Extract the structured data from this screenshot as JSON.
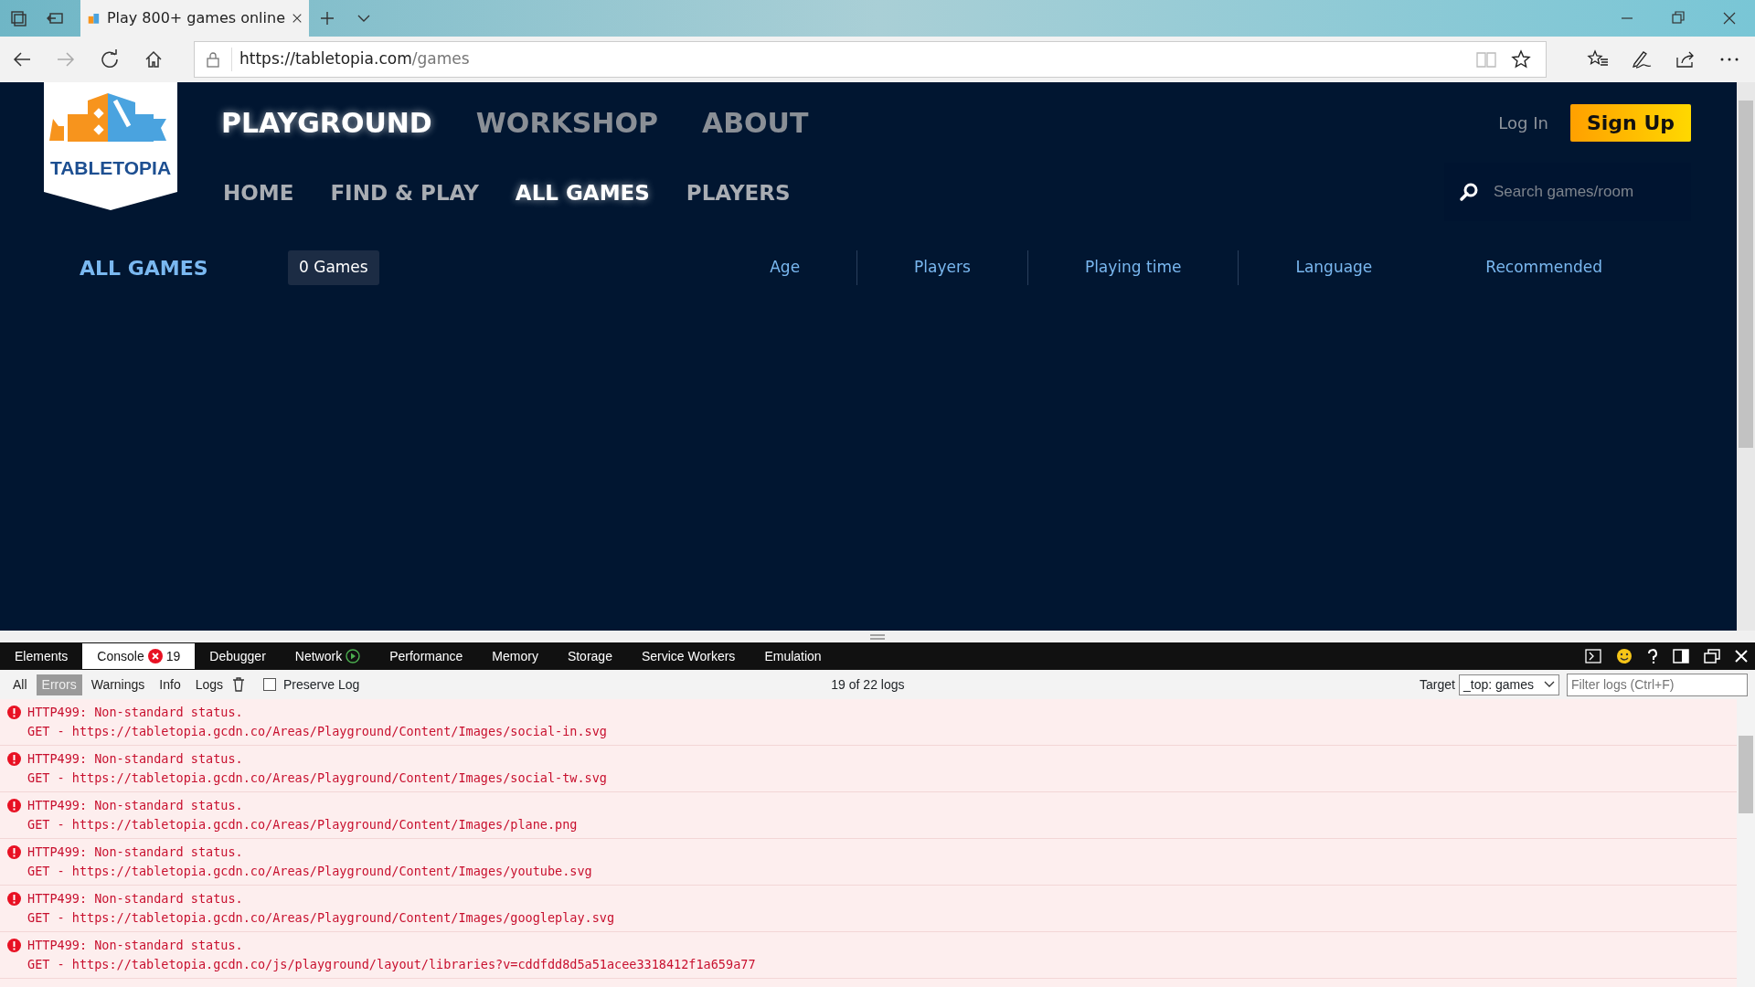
{
  "browser": {
    "tab_title": "Play 800+ games online",
    "url_host": "https://tabletopia.com",
    "url_path": "/games"
  },
  "site": {
    "logo_text": "TABLETOPIA",
    "nav_primary": [
      {
        "label": "PLAYGROUND",
        "selected": true
      },
      {
        "label": "WORKSHOP",
        "selected": false
      },
      {
        "label": "ABOUT",
        "selected": false
      }
    ],
    "nav_secondary": [
      {
        "label": "HOME",
        "selected": false
      },
      {
        "label": "FIND & PLAY",
        "selected": false
      },
      {
        "label": "ALL GAMES",
        "selected": true
      },
      {
        "label": "PLAYERS",
        "selected": false
      }
    ],
    "login": "Log In",
    "signup": "Sign Up",
    "search_placeholder": "Search games/room",
    "heading": "ALL GAMES",
    "count": "0 Games",
    "filters": [
      "Age",
      "Players",
      "Playing time",
      "Language",
      "Recommended"
    ]
  },
  "devtools": {
    "tabs": [
      {
        "label": "Elements",
        "selected": false
      },
      {
        "label": "Console",
        "selected": true,
        "badge": "19"
      },
      {
        "label": "Debugger",
        "selected": false
      },
      {
        "label": "Network",
        "selected": false
      },
      {
        "label": "Performance",
        "selected": false
      },
      {
        "label": "Memory",
        "selected": false
      },
      {
        "label": "Storage",
        "selected": false
      },
      {
        "label": "Service Workers",
        "selected": false
      },
      {
        "label": "Emulation",
        "selected": false
      }
    ],
    "levels": [
      {
        "label": "All",
        "selected": false
      },
      {
        "label": "Errors",
        "selected": true
      },
      {
        "label": "Warnings",
        "selected": false
      },
      {
        "label": "Info",
        "selected": false
      },
      {
        "label": "Logs",
        "selected": false
      }
    ],
    "preserve_log": {
      "label": "Preserve Log",
      "checked": false
    },
    "log_count": "19 of 22 logs",
    "target_label": "Target",
    "target_value": "_top: games",
    "filter_placeholder": "Filter logs (Ctrl+F)",
    "logs": [
      {
        "message": "HTTP499: Non-standard status.",
        "request": "GET - https://tabletopia.gcdn.co/Areas/Playground/Content/Images/social-in.svg"
      },
      {
        "message": "HTTP499: Non-standard status.",
        "request": "GET - https://tabletopia.gcdn.co/Areas/Playground/Content/Images/social-tw.svg"
      },
      {
        "message": "HTTP499: Non-standard status.",
        "request": "GET - https://tabletopia.gcdn.co/Areas/Playground/Content/Images/plane.png"
      },
      {
        "message": "HTTP499: Non-standard status.",
        "request": "GET - https://tabletopia.gcdn.co/Areas/Playground/Content/Images/youtube.svg"
      },
      {
        "message": "HTTP499: Non-standard status.",
        "request": "GET - https://tabletopia.gcdn.co/Areas/Playground/Content/Images/googleplay.svg"
      },
      {
        "message": "HTTP499: Non-standard status.",
        "request": "GET - https://tabletopia.gcdn.co/js/playground/layout/libraries?v=cddfdd8d5a51acee3318412f1a659a77"
      }
    ]
  }
}
